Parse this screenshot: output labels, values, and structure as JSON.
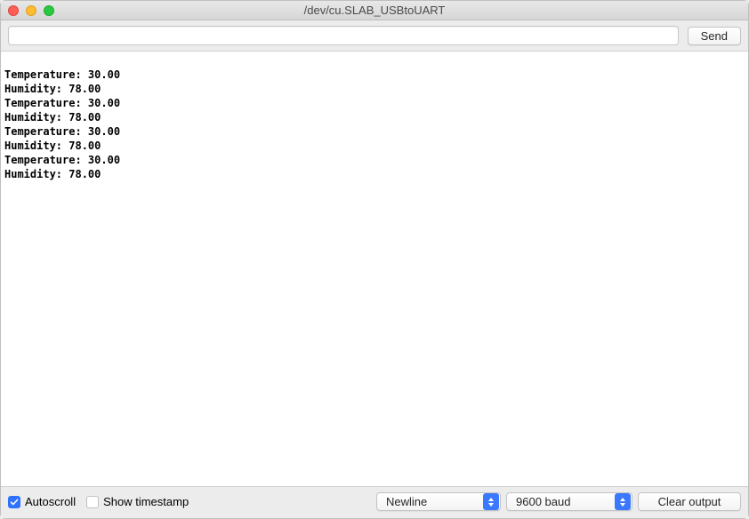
{
  "window": {
    "title": "/dev/cu.SLAB_USBtoUART"
  },
  "toolbar": {
    "send_label": "Send",
    "input_value": ""
  },
  "output_lines": [
    "Temperature: 30.00",
    "Humidity: 78.00",
    "Temperature: 30.00",
    "Humidity: 78.00",
    "Temperature: 30.00",
    "Humidity: 78.00",
    "Temperature: 30.00",
    "Humidity: 78.00"
  ],
  "footer": {
    "autoscroll_label": "Autoscroll",
    "autoscroll_checked": true,
    "timestamp_label": "Show timestamp",
    "timestamp_checked": false,
    "line_ending_selected": "Newline",
    "baud_selected": "9600 baud",
    "clear_label": "Clear output"
  }
}
